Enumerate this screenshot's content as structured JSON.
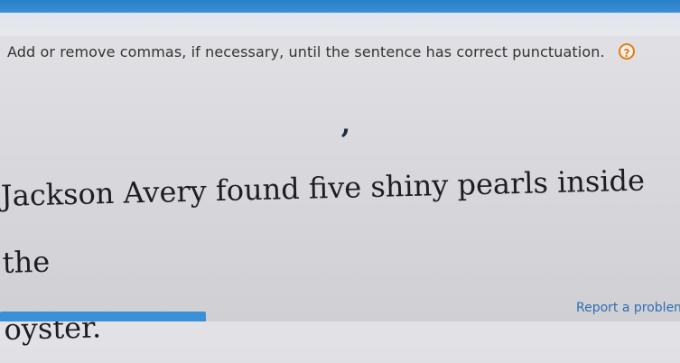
{
  "instruction": "Add or remove commas, if necessary, until the sentence has correct punctuation.",
  "help_label": "?",
  "comma_token": ",",
  "sentence": {
    "line1": [
      "Jackson",
      "Avery",
      "found",
      "five",
      "shiny",
      "pearls",
      "inside",
      "the"
    ],
    "line2": [
      "oyster."
    ]
  },
  "report_link": "Report a problem",
  "colors": {
    "accent": "#2a7fc8",
    "help_icon": "#e07d1a",
    "link": "#2f6fb1"
  }
}
